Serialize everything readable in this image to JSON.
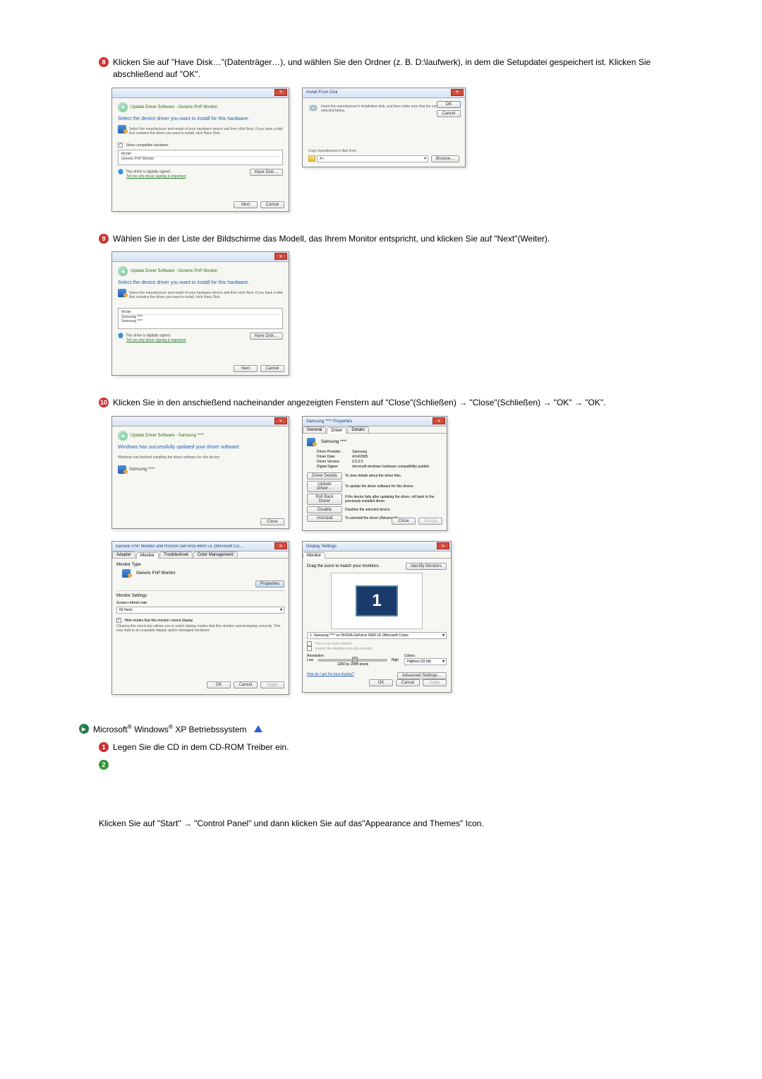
{
  "steps": {
    "step8": "Klicken Sie auf \"Have Disk…\"(Datenträger…), und wählen Sie den Ordner (z. B. D:\\laufwerk), in dem die Setupdatei gespeichert ist. Klicken Sie abschließend auf \"OK\".",
    "step9": "Wählen Sie in der Liste der Bildschirme das Modell, das Ihrem Monitor entspricht, und klicken Sie auf \"Next\"(Weiter).",
    "step10": "Klicken Sie in den anschießend nacheinander angezeigten Fenstern auf \"Close\"(Schließen) → \"Close\"(Schließen) → \"OK\" → \"OK\".",
    "xpHeader": "Microsoft® Windows® XP Betriebssystem",
    "xpStep1": "Legen Sie die CD in dem CD-ROM Treiber ein.",
    "xpFinal": "Klicken Sie auf \"Start\" → \"Control Panel\" und dann klicken Sie auf das\"Appearance and Themes\" Icon."
  },
  "dlgA": {
    "bc": "Update Driver Software - Generic PnP Monitor",
    "heading": "Select the device driver you want to install for this hardware.",
    "body": "Select the manufacturer and model of your hardware device and then click Next. If you have a disk that contains the driver you want to install, click Have Disk.",
    "chk": "Show compatible hardware",
    "hdr": "Model",
    "item": "Generic PnP Monitor",
    "sign": "This driver is digitally signed.",
    "link": "Tell me why driver signing is important",
    "have": "Have Disk…",
    "next": "Next",
    "cancel": "Cancel"
  },
  "dlgInstall": {
    "title": "Install From Disk",
    "body": "Insert the manufacturer's installation disk, and then make sure that the correct drive is selected below.",
    "copy": "Copy manufacturer's files from:",
    "path": "A:\\",
    "ok": "OK",
    "cancel": "Cancel",
    "browse": "Browse…"
  },
  "dlgB": {
    "item1": "Samsung ****",
    "item2": "Samsung ****"
  },
  "dlgC": {
    "bc": "Update Driver Software - Samsung ****",
    "heading": "Windows has successfully updated your driver software",
    "body": "Windows has finished installing the driver software for this device:",
    "dev": "Samsung ****",
    "close": "Close"
  },
  "dlgProp": {
    "title": "Samsung **** Properties",
    "tab1": "General",
    "tab2": "Driver",
    "tab3": "Details",
    "dev": "Samsung ****",
    "r1l": "Driver Provider:",
    "r1v": "Samsung",
    "r2l": "Driver Date:",
    "r2v": "4/14/2005",
    "r3l": "Driver Version:",
    "r3v": "2.0.0.0",
    "r4l": "Digital Signer:",
    "r4v": "microsoft windows hardware compatibility publish",
    "b1": "Driver Details",
    "b1d": "To view details about the driver files.",
    "b2": "Update Driver…",
    "b2d": "To update the driver software for this device.",
    "b3": "Roll Back Driver",
    "b3d": "If the device fails after updating the driver, roll back to the previously installed driver.",
    "b4": "Disable",
    "b4d": "Disables the selected device.",
    "b5": "Uninstall",
    "b5d": "To uninstall the driver (Advanced).",
    "close": "Close",
    "cancel": "Cancel"
  },
  "dlgMon": {
    "title": "Generic PnP Monitor and NVIDIA GeForce 6600 LE (Microsoft Co…",
    "tab1": "Adapter",
    "tab2": "Monitor",
    "tab3": "Troubleshoot",
    "tab4": "Color Management",
    "mt": "Monitor Type",
    "dev": "Generic PnP Monitor",
    "propbtn": "Properties",
    "ms": "Monitor Settings",
    "rr": "Screen refresh rate:",
    "hz": "60 Hertz",
    "chk": "Hide modes that this monitor cannot display",
    "desc": "Clearing this check box allows you to select display modes that this monitor cannot display correctly. This may lead to an unusable display and/or damaged hardware.",
    "ok": "OK",
    "cancel": "Cancel",
    "apply": "Apply"
  },
  "dlgDisplay": {
    "title": "Display Settings",
    "tab": "Monitor",
    "drag": "Drag the icons to match your monitors.",
    "identify": "Identify Monitors",
    "num": "1",
    "sel": "1. Samsung **** on NVIDIA GeForce 6600 LE (Microsoft Corpo",
    "c1": "This is my main monitor",
    "c2": "Extend the desktop onto this monitor",
    "resLbl": "Resolution:",
    "low": "Low",
    "high": "High",
    "resVal": "1280 by 1024 pixels",
    "colLbl": "Colors:",
    "colVal": "Highest (32 bit)",
    "link": "How do I get the best display?",
    "adv": "Advanced Settings…",
    "ok": "OK",
    "cancel": "Cancel",
    "apply": "Apply"
  }
}
